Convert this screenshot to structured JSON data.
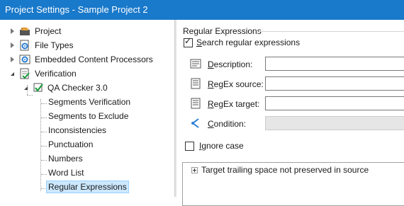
{
  "window": {
    "title": "Project Settings - Sample Project 2"
  },
  "tree": {
    "items": [
      {
        "label": "Project",
        "state": "collapsed",
        "icon": "project-icon"
      },
      {
        "label": "File Types",
        "state": "collapsed",
        "icon": "file-types-icon"
      },
      {
        "label": "Embedded Content Processors",
        "state": "collapsed",
        "icon": "embedded-content-icon"
      },
      {
        "label": "Verification",
        "state": "expanded",
        "icon": "verification-icon"
      },
      {
        "label": "QA Checker 3.0",
        "state": "expanded",
        "icon": "qa-checker-icon"
      },
      {
        "label": "Segments Verification"
      },
      {
        "label": "Segments to Exclude"
      },
      {
        "label": "Inconsistencies"
      },
      {
        "label": "Punctuation"
      },
      {
        "label": "Numbers"
      },
      {
        "label": "Word List"
      },
      {
        "label": "Regular Expressions",
        "selected": true
      }
    ]
  },
  "panel": {
    "group_title": "Regular Expressions",
    "search_checkbox": {
      "label": "Search regular expressions",
      "checked": true
    },
    "fields": {
      "description": {
        "label": "Description:",
        "value": ""
      },
      "regex_source": {
        "label": "RegEx source:",
        "value": ""
      },
      "regex_target": {
        "label": "RegEx target:",
        "value": ""
      },
      "condition": {
        "label": "Condition:",
        "value": "",
        "disabled": true
      }
    },
    "ignore_case": {
      "label": "Ignore case",
      "checked": false
    },
    "results": [
      {
        "label": "Target trailing space not preserved in source"
      }
    ]
  },
  "colors": {
    "titlebar": "#1979ca",
    "selection": "#cce8ff",
    "condition_icon": "#2a7fd4"
  }
}
